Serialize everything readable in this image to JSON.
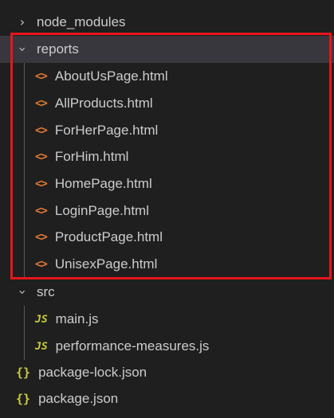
{
  "explorer": {
    "node_modules": {
      "label": "node_modules",
      "icon": "chevron-right-icon"
    },
    "reports": {
      "label": "reports",
      "icon": "chevron-down-icon",
      "files": [
        {
          "name": "AboutUsPage.html",
          "glyph": "<>"
        },
        {
          "name": "AllProducts.html",
          "glyph": "<>"
        },
        {
          "name": "ForHerPage.html",
          "glyph": "<>"
        },
        {
          "name": "ForHim.html",
          "glyph": "<>"
        },
        {
          "name": "HomePage.html",
          "glyph": "<>"
        },
        {
          "name": "LoginPage.html",
          "glyph": "<>"
        },
        {
          "name": "ProductPage.html",
          "glyph": "<>"
        },
        {
          "name": "UnisexPage.html",
          "glyph": "<>"
        }
      ]
    },
    "src": {
      "label": "src",
      "icon": "chevron-down-icon",
      "files": [
        {
          "name": "main.js",
          "glyph": "JS"
        },
        {
          "name": "performance-measures.js",
          "glyph": "JS"
        }
      ]
    },
    "root_files": [
      {
        "name": "package-lock.json",
        "glyph": "{}"
      },
      {
        "name": "package.json",
        "glyph": "{}"
      }
    ],
    "colors": {
      "background": "#1f1f1f",
      "selected_row": "#37373d",
      "html_icon": "#e37933",
      "js_icon": "#cbcb41",
      "json_icon": "#cbcb41",
      "highlight_box": "#e8151b"
    }
  }
}
